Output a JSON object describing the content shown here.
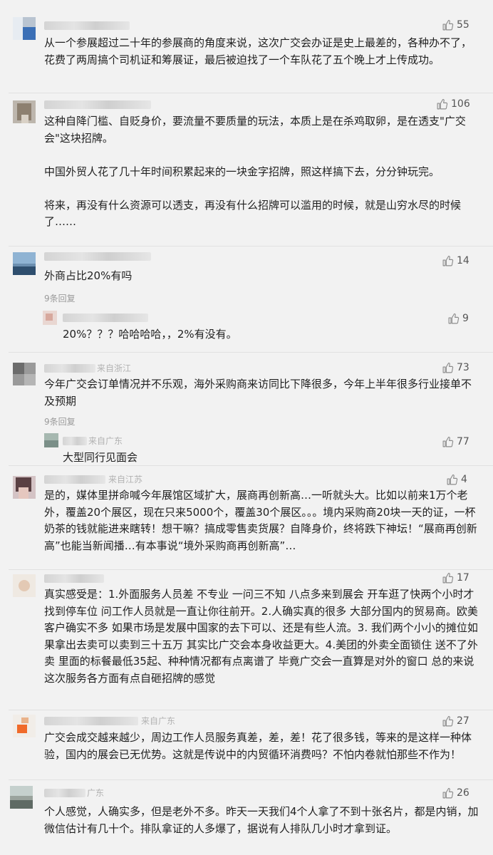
{
  "comments": [
    {
      "likes": "55",
      "text": "从一个参展超过二十年的参展商的角度来说，这次广交会办证是史上最差的，各种办不了，花费了两周搞个司机证和筹展证，最后被迫找了一个车队花了五个晚上才上传成功。"
    },
    {
      "likes": "106",
      "text": "这种自降门槛、自贬身价，要流量不要质量的玩法，本质上是在杀鸡取卵，是在透支\"广交会\"这块招牌。\n\n中国外贸人花了几十年时间积累起来的一块金字招牌，照这样搞下去，分分钟玩完。\n\n将来，再没有什么资源可以透支，再没有什么招牌可以滥用的时候，就是山穷水尽的时候了……"
    },
    {
      "likes": "14",
      "text": "外商占比20%有吗",
      "replies_label": "9条回复",
      "reply": {
        "likes": "9",
        "text": "20%？？？哈哈哈哈，，2%有没有。"
      }
    },
    {
      "likes": "73",
      "location": "来自浙江",
      "text": "今年广交会订单情况并不乐观，海外采购商来访同比下降很多，今年上半年很多行业接单不及预期",
      "replies_label": "9条回复",
      "reply": {
        "likes": "77",
        "location": "来自广东",
        "text": "大型同行见面会"
      }
    },
    {
      "likes": "4",
      "location": "来自江苏",
      "text": "是的，媒体里拼命喊今年展馆区域扩大，展商再创新高…一听就头大。比如以前来1万个老外，覆盖20个展区，现在只来5000个，覆盖30个展区。。。境内采购商20块一天的证，一杯奶茶的钱就能进来瞎转！想干嘛？搞成零售卖货展？自降身价，终将跌下神坛！“展商再创新高”也能当新闻播…有本事说“境外采购商再创新高”…"
    },
    {
      "likes": "17",
      "text": "真实感受是：1.外面服务人员差 不专业 一问三不知 八点多来到展会 开车逛了快两个小时才找到停车位 问工作人员就是一直让你往前开。2.人确实真的很多 大部分国内的贸易商。欧美客户确实不多 如果市场是发展中国家的去下可以、还是有些人流。3. 我们两个小小的摊位如果拿出去卖可以卖到三十五万 其实比广交会本身收益更大。4.美团的外卖全面锁住 送不了外卖 里面的标餐最低35起、种种情况都有点离谱了 毕竟广交会一直算是对外的窗口 总的来说 这次服务各方面有点自砸招牌的感觉"
    },
    {
      "likes": "27",
      "location": "来自广东",
      "text": "广交会成交越来越少，周边工作人员服务真差，差，差！花了很多钱，等来的是这样一种体验，国内的展会已无优势。这就是传说中的内贸循环消费吗？不怕内卷就怕那些不作为！"
    },
    {
      "likes": "26",
      "location": "广东",
      "text": "个人感觉，人确实多，但是老外不多。昨天一天我们4个人拿了不到十张名片，都是内销，加微信估计有几十个。排队拿证的人多爆了，据说有人排队几小时才拿到证。"
    }
  ]
}
